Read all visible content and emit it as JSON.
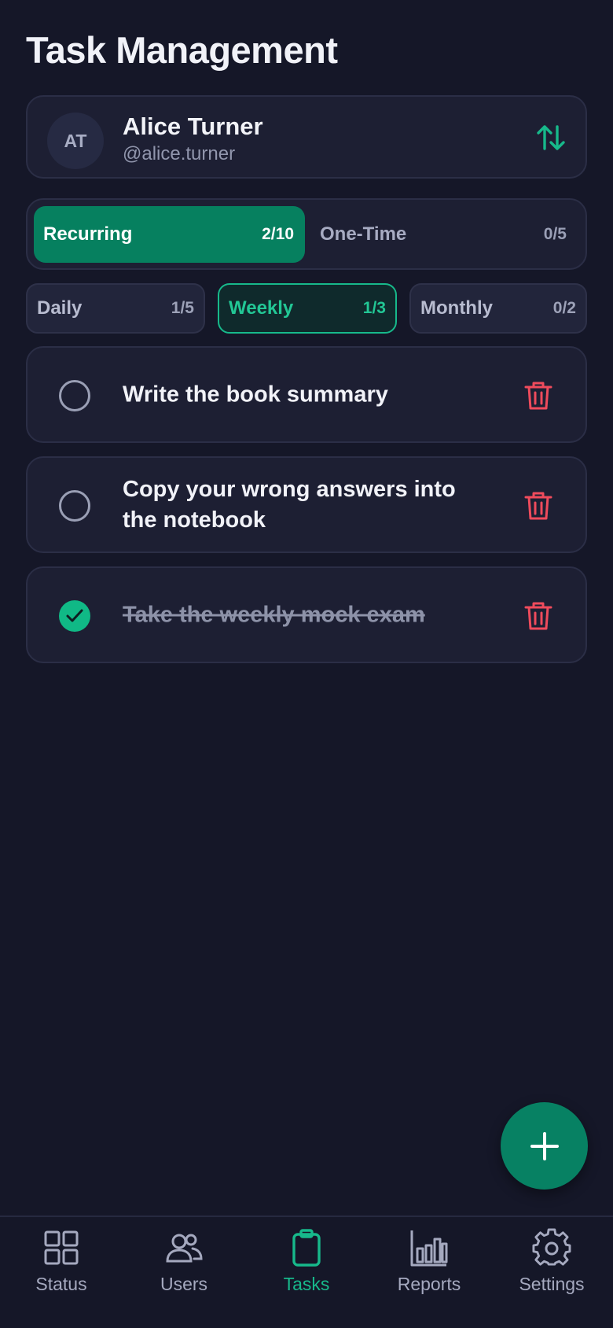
{
  "header": {
    "title": "Task Management"
  },
  "user": {
    "initials": "AT",
    "name": "Alice Turner",
    "handle": "@alice.turner"
  },
  "segments": [
    {
      "label": "Recurring",
      "count": "2/10",
      "active": true
    },
    {
      "label": "One-Time",
      "count": "0/5",
      "active": false
    }
  ],
  "subtabs": [
    {
      "label": "Daily",
      "count": "1/5",
      "active": false
    },
    {
      "label": "Weekly",
      "count": "1/3",
      "active": true
    },
    {
      "label": "Monthly",
      "count": "0/2",
      "active": false
    }
  ],
  "tasks": [
    {
      "text": "Write the book summary",
      "done": false
    },
    {
      "text": "Copy your wrong answers into the notebook",
      "done": false
    },
    {
      "text": "Take the weekly mock exam",
      "done": true
    }
  ],
  "nav": [
    {
      "label": "Status",
      "icon": "grid-icon",
      "active": false
    },
    {
      "label": "Users",
      "icon": "users-icon",
      "active": false
    },
    {
      "label": "Tasks",
      "icon": "clipboard-icon",
      "active": true
    },
    {
      "label": "Reports",
      "icon": "bar-chart-icon",
      "active": false
    },
    {
      "label": "Settings",
      "icon": "gear-icon",
      "active": false
    }
  ],
  "colors": {
    "background": "#151728",
    "card": "#1d1f33",
    "accent": "#17b98b",
    "accent_dark": "#06805f",
    "danger": "#ef4b5c"
  }
}
